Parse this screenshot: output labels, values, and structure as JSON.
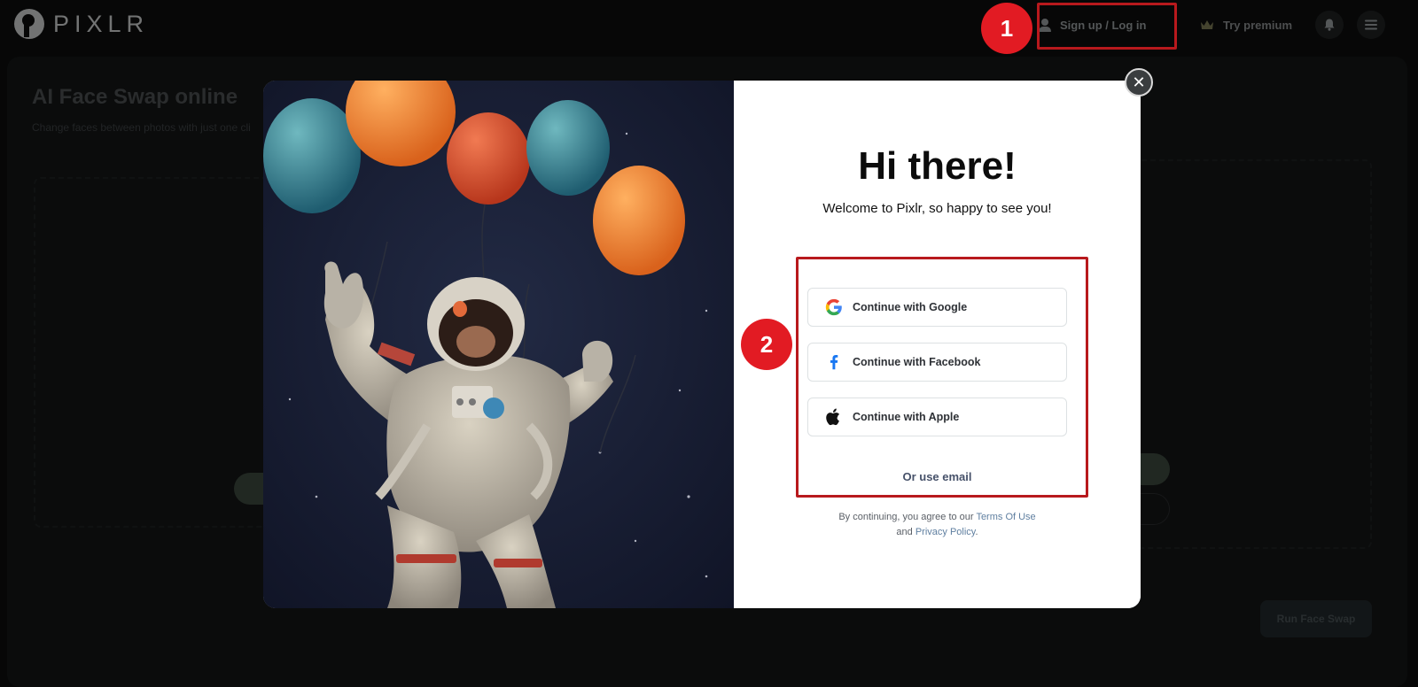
{
  "brand": {
    "logo_text": "PIXLR"
  },
  "nav": {
    "signup_label": "Sign up / Log in",
    "premium_label": "Try premium",
    "annotation_1": "1"
  },
  "page": {
    "title": "AI Face Swap online",
    "subtitle": "Change faces between photos with just one cli",
    "run_button": "Run Face Swap"
  },
  "modal": {
    "title": "Hi there!",
    "subtitle": "Welcome to Pixlr, so happy to see you!",
    "buttons": {
      "google": "Continue with Google",
      "facebook": "Continue with Facebook",
      "apple": "Continue with Apple"
    },
    "email_link": "Or use email",
    "terms_prefix": "By continuing, you agree to our",
    "terms_link": "Terms Of Use",
    "terms_and": "and",
    "privacy_link": "Privacy Policy",
    "terms_period": ".",
    "close_glyph": "✕",
    "annotation_2": "2"
  },
  "colors": {
    "annotation_red": "#e21b23",
    "annotation_border": "#b8191d",
    "background": "#0d0e0e",
    "facebook_blue": "#1877f2"
  },
  "icons": {
    "user": "person-icon",
    "premium": "crown-icon",
    "notifications": "bell-icon",
    "menu": "hamburger-icon",
    "google": "google-icon",
    "facebook": "facebook-icon",
    "apple": "apple-icon",
    "close": "close-icon"
  }
}
